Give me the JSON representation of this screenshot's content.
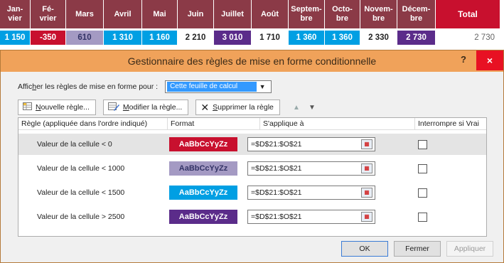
{
  "sheet": {
    "headers": [
      "Jan-\nvier",
      "Fé-\nvrier",
      "Mars",
      "Avril",
      "Mai",
      "Juin",
      "Juillet",
      "Août",
      "Septem-\nbre",
      "Octo-\nbre",
      "Novem-\nbre",
      "Décem-\nbre",
      "Total"
    ],
    "values": [
      "1 150",
      "-350",
      "610",
      "1 310",
      "1 160",
      "2 210",
      "3 010",
      "1 710",
      "1 360",
      "1 360",
      "2 330",
      "2 730",
      "2 730"
    ],
    "cell_colors": [
      "#009fe3",
      "#c8102e",
      "#a49ac3",
      "#009fe3",
      "#009fe3",
      "#ffffff",
      "#5b2c8a",
      "#ffffff",
      "#009fe3",
      "#009fe3",
      "#ffffff",
      "#5b2c8a",
      "#ffffff"
    ],
    "cell_text_colors": [
      "#ffffff",
      "#ffffff",
      "#333366",
      "#ffffff",
      "#ffffff",
      "#222222",
      "#ffffff",
      "#222222",
      "#ffffff",
      "#ffffff",
      "#222222",
      "#ffffff",
      "#666666"
    ]
  },
  "dialog": {
    "title": "Gestionnaire des règles de mise en forme conditionnelle",
    "help": "?",
    "close": "×",
    "show_rules_for_pre": "Affic",
    "show_rules_for_u": "h",
    "show_rules_for_post": "er les règles de mise en forme pour :",
    "show_rules_value": "Cette feuille de calcul",
    "new_rule_u": "N",
    "new_rule": "ouvelle règle...",
    "edit_rule_u": "M",
    "edit_rule": "odifier la règle...",
    "delete_rule_u": "S",
    "delete_rule": "upprimer la règle",
    "columns": {
      "rule": "Règle (appliquée dans l'ordre indiqué)",
      "format": "Format",
      "applies_to": "S'applique à",
      "stop": "Interrompre si Vrai"
    },
    "rules": [
      {
        "name": "Valeur de la cellule < 0",
        "preview": "AaBbCcYyZz",
        "bg": "#c8102e",
        "fg": "#ffffff",
        "applies": "=$D$21:$O$21"
      },
      {
        "name": "Valeur de la cellule < 1000",
        "preview": "AaBbCcYyZz",
        "bg": "#a49ac3",
        "fg": "#333366",
        "applies": "=$D$21:$O$21"
      },
      {
        "name": "Valeur de la cellule < 1500",
        "preview": "AaBbCcYyZz",
        "bg": "#009fe3",
        "fg": "#ffffff",
        "applies": "=$D$21:$O$21"
      },
      {
        "name": "Valeur de la cellule > 2500",
        "preview": "AaBbCcYyZz",
        "bg": "#5b2c8a",
        "fg": "#ffffff",
        "applies": "=$D$21:$O$21"
      }
    ],
    "ok": "OK",
    "close_btn": "Fermer",
    "apply": "Appliquer",
    "titlebar_color": "#f0a25a"
  }
}
